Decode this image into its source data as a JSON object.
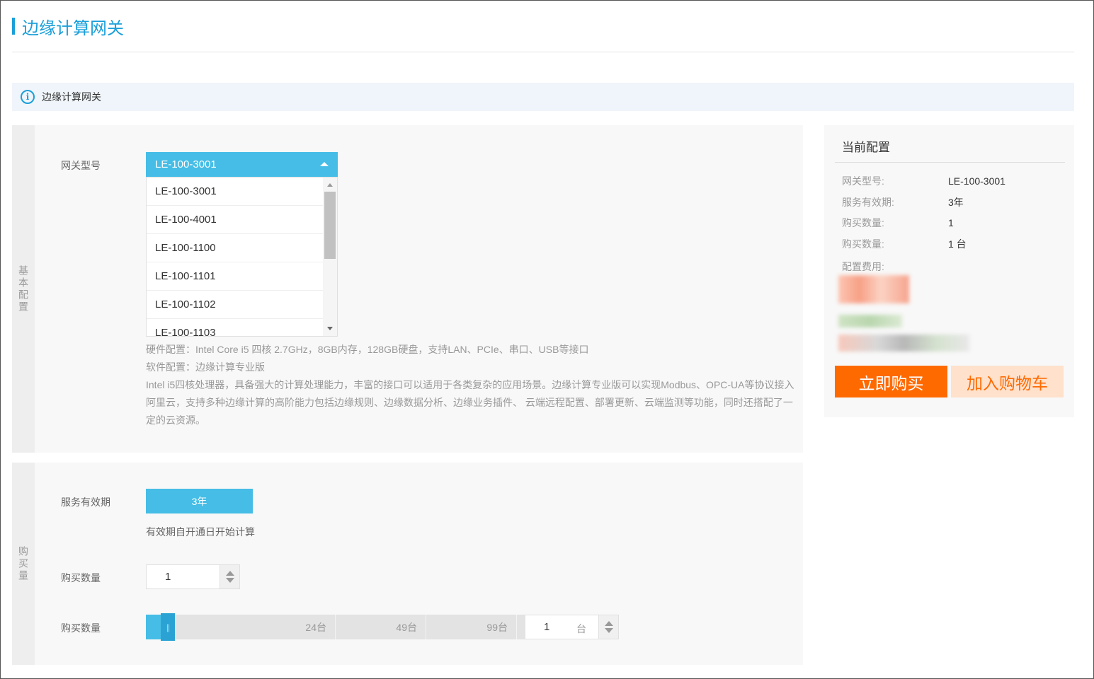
{
  "page": {
    "title": "边缘计算网关"
  },
  "info_bar": {
    "text": "边缘计算网关"
  },
  "basic_config": {
    "section_label": "基本配置",
    "model_label": "网关型号",
    "selected_model": "LE-100-3001",
    "options": [
      "LE-100-3001",
      "LE-100-4001",
      "LE-100-1100",
      "LE-100-1101",
      "LE-100-1102",
      "LE-100-1103"
    ],
    "hardware": "硬件配置：Intel Core i5 四核 2.7GHz，8GB内存，128GB硬盘，支持LAN、PCIe、串口、USB等接口",
    "software": "软件配置：边缘计算专业版",
    "description": "Intel i5四核处理器，具备强大的计算处理能力，丰富的接口可以适用于各类复杂的应用场景。边缘计算专业版可以实现Modbus、OPC-UA等协议接入阿里云，支持多种边缘计算的高阶能力包括边缘规则、边缘数据分析、边缘业务插件、 云端远程配置、部署更新、云端监测等功能，同时还搭配了一定的云资源。"
  },
  "purchase": {
    "section_label": "购买量",
    "duration_label": "服务有效期",
    "duration_value": "3年",
    "duration_hint": "有效期自开通日开始计算",
    "quantity_label": "购买数量",
    "quantity_value": "1",
    "slider_label": "购买数量",
    "slider_marks": [
      "24台",
      "49台",
      "99台"
    ],
    "slider_value": "1",
    "slider_unit": "台",
    "slider_fraction": 0.04
  },
  "summary": {
    "title": "当前配置",
    "rows": [
      {
        "key": "网关型号:",
        "value": "LE-100-3001"
      },
      {
        "key": "服务有效期:",
        "value": "3年"
      },
      {
        "key": "购买数量:",
        "value": "1"
      },
      {
        "key": "购买数量:",
        "value": "1 台"
      }
    ],
    "cost_label": "配置费用:",
    "buy_label": "立即购买",
    "cart_label": "加入购物车"
  },
  "colors": {
    "accent": "#45bde6",
    "title_blue": "#1a9fd9",
    "buy_orange": "#ff6a00",
    "cart_bg": "#ffe1cc"
  }
}
